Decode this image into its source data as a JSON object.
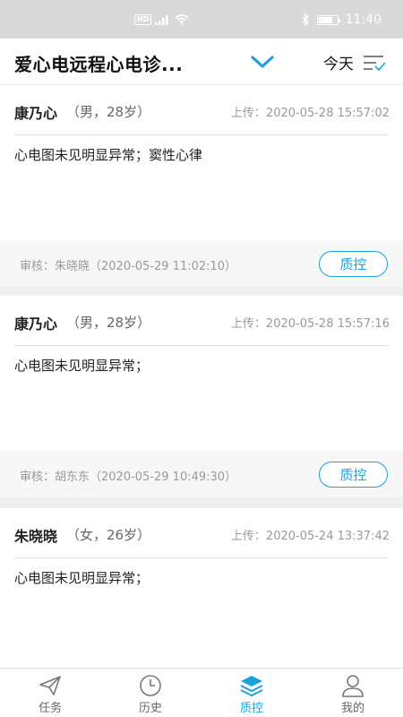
{
  "status_bar": {
    "hd": "HD",
    "time": "11:40",
    "battery_level": 0.75
  },
  "header": {
    "title": "爱心电远程心电诊...",
    "date_filter": "今天",
    "accent_color": "#1aa3d9"
  },
  "records": [
    {
      "name": "康乃心",
      "info": "（男，28岁）",
      "upload": "上传：2020-05-28 15:57:02",
      "diagnosis": "心电图未见明显异常；窦性心律",
      "review": "审核：朱晓晓（2020-05-29 11:02:10）",
      "action": "质控"
    },
    {
      "name": "康乃心",
      "info": "（男，28岁）",
      "upload": "上传：2020-05-28 15:57:16",
      "diagnosis": "心电图未见明显异常；",
      "review": "审核：胡东东（2020-05-29 10:49:30）",
      "action": "质控"
    },
    {
      "name": "朱晓晓",
      "info": "（女，26岁）",
      "upload": "上传：2020-05-24 13:37:42",
      "diagnosis": "心电图未见明显异常；",
      "review": "",
      "action": ""
    }
  ],
  "tabs": [
    {
      "label": "任务",
      "icon": "send-icon",
      "active": false
    },
    {
      "label": "历史",
      "icon": "clock-icon",
      "active": false
    },
    {
      "label": "质控",
      "icon": "layers-icon",
      "active": true
    },
    {
      "label": "我的",
      "icon": "user-icon",
      "active": false
    }
  ]
}
